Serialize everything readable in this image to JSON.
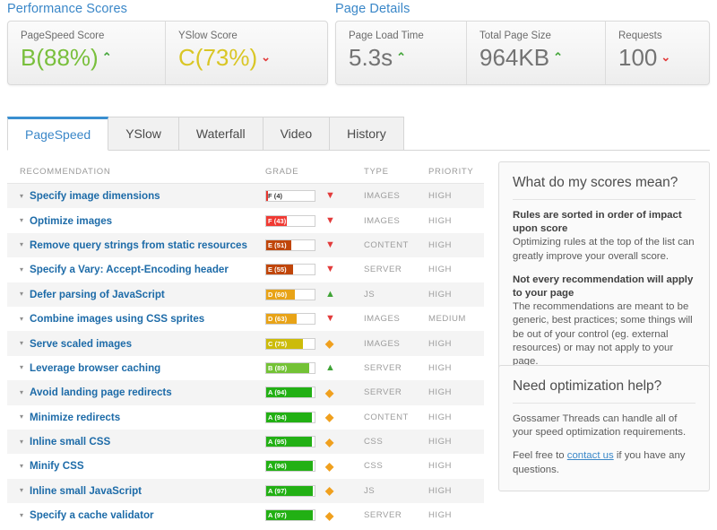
{
  "performance": {
    "section_title": "Performance Scores",
    "metrics": [
      {
        "label": "PageSpeed Score",
        "grade": "B",
        "value": "(88%)",
        "trend": "up",
        "trend_glyph": "⌃",
        "color": "#79bf3c"
      },
      {
        "label": "YSlow Score",
        "grade": "C",
        "value": "(73%)",
        "trend": "down",
        "trend_glyph": "⌄",
        "color": "#d9c625"
      }
    ]
  },
  "page_details": {
    "section_title": "Page Details",
    "metrics": [
      {
        "label": "Page Load Time",
        "value": "5.3s",
        "trend": "up",
        "trend_glyph": "⌃"
      },
      {
        "label": "Total Page Size",
        "value": "964KB",
        "trend": "up",
        "trend_glyph": "⌃"
      },
      {
        "label": "Requests",
        "value": "100",
        "trend": "down",
        "trend_glyph": "⌄"
      }
    ]
  },
  "tabs": [
    {
      "label": "PageSpeed",
      "active": true
    },
    {
      "label": "YSlow",
      "active": false
    },
    {
      "label": "Waterfall",
      "active": false
    },
    {
      "label": "Video",
      "active": false
    },
    {
      "label": "History",
      "active": false
    }
  ],
  "table": {
    "headers": {
      "recommendation": "RECOMMENDATION",
      "grade": "GRADE",
      "type": "TYPE",
      "priority": "PRIORITY"
    },
    "rows": [
      {
        "caret": "▾",
        "recommendation": "Specify image dimensions",
        "grade_label": "F (4)",
        "score": 4,
        "grade_letter": "F",
        "fill_color": "#e8362f",
        "text_color": "#333333",
        "arrow": "down",
        "type": "IMAGES",
        "priority": "HIGH"
      },
      {
        "caret": "▾",
        "recommendation": "Optimize images",
        "grade_label": "F (43)",
        "score": 43,
        "grade_letter": "F",
        "fill_color": "#f03a33",
        "text_color": "#ffffff",
        "arrow": "down",
        "type": "IMAGES",
        "priority": "HIGH"
      },
      {
        "caret": "▾",
        "recommendation": "Remove query strings from static resources",
        "grade_label": "E (51)",
        "score": 51,
        "grade_letter": "E",
        "fill_color": "#c0460a",
        "text_color": "#ffffff",
        "arrow": "down",
        "type": "CONTENT",
        "priority": "HIGH"
      },
      {
        "caret": "▾",
        "recommendation": "Specify a Vary: Accept-Encoding header",
        "grade_label": "E (55)",
        "score": 55,
        "grade_letter": "E",
        "fill_color": "#c0460a",
        "text_color": "#ffffff",
        "arrow": "down",
        "type": "SERVER",
        "priority": "HIGH"
      },
      {
        "caret": "▾",
        "recommendation": "Defer parsing of JavaScript",
        "grade_label": "D (60)",
        "score": 60,
        "grade_letter": "D",
        "fill_color": "#e8a317",
        "text_color": "#ffffff",
        "arrow": "up",
        "type": "JS",
        "priority": "HIGH"
      },
      {
        "caret": "▾",
        "recommendation": "Combine images using CSS sprites",
        "grade_label": "D (63)",
        "score": 63,
        "grade_letter": "D",
        "fill_color": "#e8a317",
        "text_color": "#ffffff",
        "arrow": "down",
        "type": "IMAGES",
        "priority": "MEDIUM"
      },
      {
        "caret": "▾",
        "recommendation": "Serve scaled images",
        "grade_label": "C (75)",
        "score": 75,
        "grade_letter": "C",
        "fill_color": "#ccbb09",
        "text_color": "#ffffff",
        "arrow": "flat",
        "type": "IMAGES",
        "priority": "HIGH"
      },
      {
        "caret": "▾",
        "recommendation": "Leverage browser caching",
        "grade_label": "B (89)",
        "score": 89,
        "grade_letter": "B",
        "fill_color": "#73c235",
        "text_color": "#ffffff",
        "arrow": "up",
        "type": "SERVER",
        "priority": "HIGH"
      },
      {
        "caret": "▾",
        "recommendation": "Avoid landing page redirects",
        "grade_label": "A (94)",
        "score": 94,
        "grade_letter": "A",
        "fill_color": "#22b014",
        "text_color": "#ffffff",
        "arrow": "flat",
        "type": "SERVER",
        "priority": "HIGH"
      },
      {
        "caret": "▾",
        "recommendation": "Minimize redirects",
        "grade_label": "A (94)",
        "score": 94,
        "grade_letter": "A",
        "fill_color": "#22b014",
        "text_color": "#ffffff",
        "arrow": "flat",
        "type": "CONTENT",
        "priority": "HIGH"
      },
      {
        "caret": "▾",
        "recommendation": "Inline small CSS",
        "grade_label": "A (95)",
        "score": 95,
        "grade_letter": "A",
        "fill_color": "#22b014",
        "text_color": "#ffffff",
        "arrow": "flat",
        "type": "CSS",
        "priority": "HIGH"
      },
      {
        "caret": "▾",
        "recommendation": "Minify CSS",
        "grade_label": "A (96)",
        "score": 96,
        "grade_letter": "A",
        "fill_color": "#22b014",
        "text_color": "#ffffff",
        "arrow": "flat",
        "type": "CSS",
        "priority": "HIGH"
      },
      {
        "caret": "▾",
        "recommendation": "Inline small JavaScript",
        "grade_label": "A (97)",
        "score": 97,
        "grade_letter": "A",
        "fill_color": "#22b014",
        "text_color": "#ffffff",
        "arrow": "flat",
        "type": "JS",
        "priority": "HIGH"
      },
      {
        "caret": "▾",
        "recommendation": "Specify a cache validator",
        "grade_label": "A (97)",
        "score": 97,
        "grade_letter": "A",
        "fill_color": "#22b014",
        "text_color": "#ffffff",
        "arrow": "flat",
        "type": "SERVER",
        "priority": "HIGH"
      }
    ]
  },
  "sidebar": {
    "scores_panel": {
      "title": "What do my scores mean?",
      "para1_heading": "Rules are sorted in order of impact upon score",
      "para1_body": "Optimizing rules at the top of the list can greatly improve your overall score.",
      "para2_heading": "Not every recommendation will apply to your page",
      "para2_body": "The recommendations are meant to be generic, best practices; some things will be out of your control (eg. external resources) or may not apply to your page."
    },
    "help_panel": {
      "title": "Need optimization help?",
      "para1": "Gossamer Threads can handle all of your speed optimization requirements.",
      "para2_pre": "Feel free to ",
      "link_text": "contact us",
      "para2_post": " if you have any questions."
    }
  },
  "arrow_glyphs": {
    "up": "▲",
    "down": "▼",
    "flat": "◆"
  }
}
